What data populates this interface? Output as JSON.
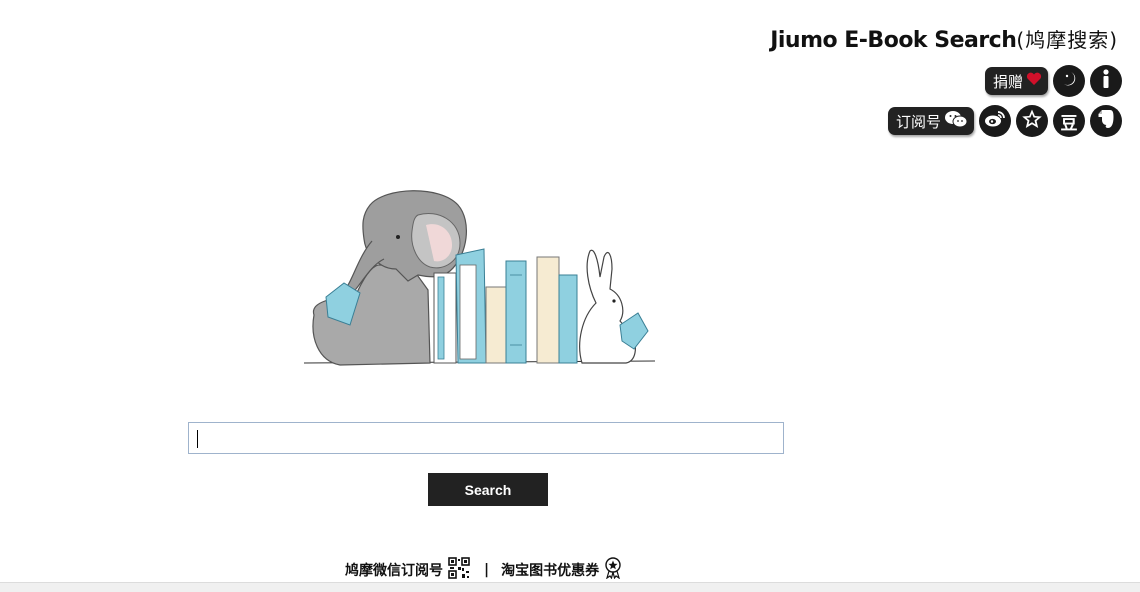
{
  "header": {
    "title_en": "Jiumo E-Book Search",
    "title_cn": "(鸠摩搜索)"
  },
  "toolbar": {
    "donate_label": "捐赠",
    "subscribe_label": "订阅号",
    "douban_glyph": "豆",
    "icons": [
      "heart-icon",
      "night-mode-icon",
      "info-icon",
      "wechat-icon",
      "weibo-icon",
      "star-icon",
      "douban-icon",
      "evernote-icon"
    ]
  },
  "search": {
    "value": "",
    "button_label": "Search"
  },
  "footer": {
    "wechat_link": "鸠摩微信订阅号",
    "separator": "|",
    "taobao_link": "淘宝图书优惠券"
  },
  "colors": {
    "accent": "#222222",
    "heart": "#d0102a",
    "input_border": "#9fb3cc",
    "book_blue": "#8fd0e0",
    "book_cream": "#f6ebd2"
  }
}
